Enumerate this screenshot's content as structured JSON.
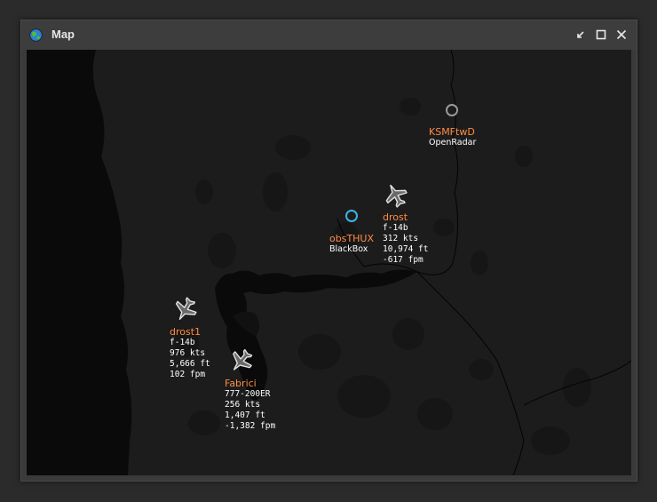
{
  "window": {
    "title": "Map",
    "icon": "globe-icon",
    "controls": [
      "restore-icon",
      "maximize-icon",
      "close-icon"
    ]
  },
  "aircraft": [
    {
      "callsign": "drost",
      "type": "f-14b",
      "speed": "312 kts",
      "altitude": "10,974 ft",
      "vs": "-617 fpm"
    },
    {
      "callsign": "drost1",
      "type": "f-14b",
      "speed": "976 kts",
      "altitude": "5,666 ft",
      "vs": "102 fpm"
    },
    {
      "callsign": "Fabrici",
      "type": "777-200ER",
      "speed": "256 kts",
      "altitude": "1,407 ft",
      "vs": "-1,382 fpm"
    }
  ],
  "stations": [
    {
      "name": "obsTHUX",
      "kind": "BlackBox",
      "color": "#3cb4e6"
    },
    {
      "name": "KSMFtwD",
      "kind": "OpenRadar",
      "color": "#9a9a9a"
    }
  ],
  "colors": {
    "callsign": "#ff8c42",
    "land": "#1c1c1c",
    "water": "#0a0a0a"
  }
}
